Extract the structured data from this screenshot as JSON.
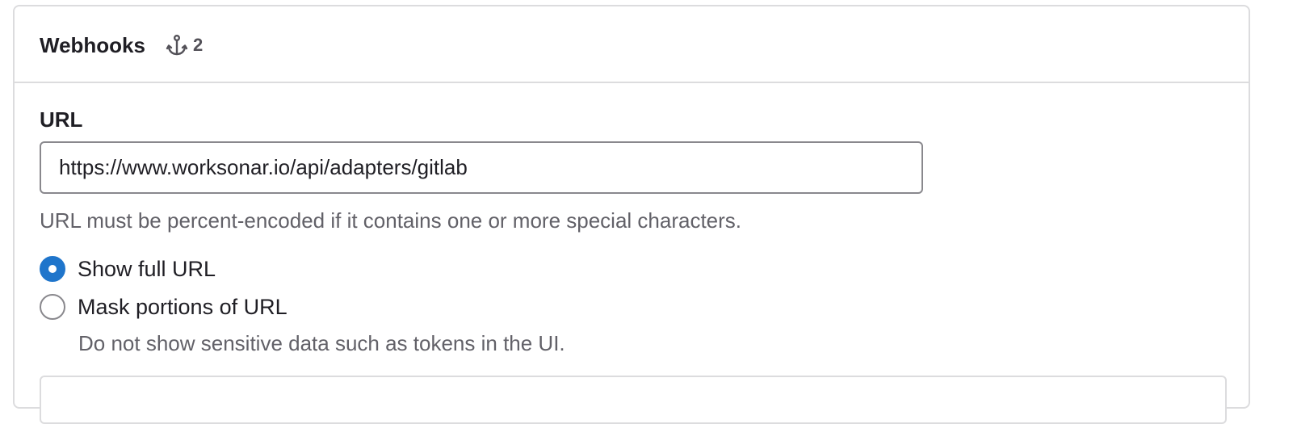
{
  "card": {
    "title": "Webhooks",
    "count_icon": "webhook-icon",
    "count": "2"
  },
  "url_field": {
    "label": "URL",
    "value": "https://www.worksonar.io/api/adapters/gitlab",
    "help": "URL must be percent-encoded if it contains one or more special characters."
  },
  "url_display": {
    "options": [
      {
        "label": "Show full URL",
        "checked": true
      },
      {
        "label": "Mask portions of URL",
        "checked": false
      }
    ],
    "mask_help": "Do not show sensitive data such as tokens in the UI."
  },
  "colors": {
    "accent": "#1f75cb",
    "border": "#dcdcde",
    "text": "#1f1e24",
    "muted": "#626168"
  }
}
